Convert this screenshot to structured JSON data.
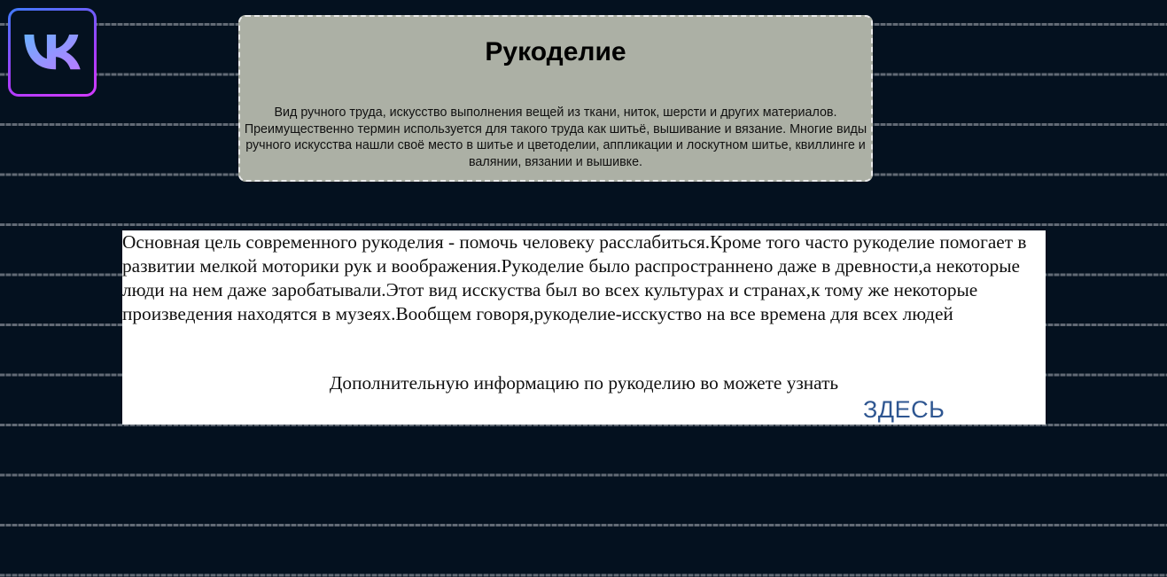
{
  "logo": {
    "icon": "vk-logo-icon",
    "colors": {
      "from": "#6bb0ff",
      "to": "#b87cff",
      "border_from": "#3f7bff",
      "border_to": "#d33bff"
    }
  },
  "header": {
    "title": "Рукоделие",
    "description": "Вид ручного труда, искусство выполнения вещей из ткани, ниток, шерсти и других материалов. Преимущественно термин используется для такого труда как шитьё, вышивание и вязание. Многие виды ручного искусства нашли своё место в шитье и цветоделии, аппликации и лоскутном шитье, квиллинге и валянии, вязании и вышивке."
  },
  "content": {
    "text": "Основная цель современного рукоделия - помочь человеку расслабиться.Кроме того часто рукоделие помогает в развитии мелкой моторики рук и воображения.Рукоделие было распространнено даже в древности,а некоторые люди на нем даже заробатывали.Этот вид исскуства был во всех культурах и странах,к тому же некоторые произведения находятся в музеях.Вообщем говоря,рукоделие-исскуство на все времена для всех людей",
    "more_info": "Дополнительную информацию по рукоделию во можете узнать",
    "link_label": "ЗДЕСЬ"
  },
  "colors": {
    "background": "#04111f",
    "header_box": "#acb0a5",
    "link": "#2e5691"
  }
}
